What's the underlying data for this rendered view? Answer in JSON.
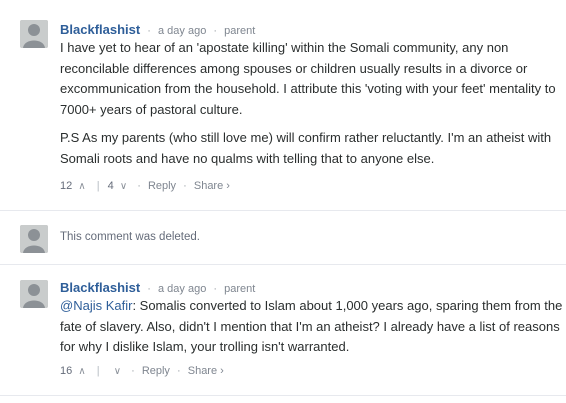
{
  "comments": [
    {
      "author": "Blackflashist",
      "time": "a day ago",
      "parent_label": "parent",
      "paragraphs": [
        "I have yet to hear of an 'apostate killing' within the Somali community, any non reconcilable differences among spouses or children usually results in a divorce or excommunication from the household. I attribute this 'voting with your feet' mentality to 7000+ years of pastoral culture.",
        "P.S As my parents (who still love me) will confirm rather reluctantly. I'm an atheist with Somali roots and have no qualms with telling that to anyone else."
      ],
      "upvotes": "12",
      "downvotes": "4",
      "reply_label": "Reply",
      "share_label": "Share ›"
    },
    {
      "deleted_text": "This comment was deleted."
    },
    {
      "author": "Blackflashist",
      "time": "a day ago",
      "parent_label": "parent",
      "mention": "@Najis Kafir",
      "text_after_mention": ": Somalis converted to Islam about 1,000 years ago, sparing them from the fate of slavery. Also, didn't I mention that I'm an atheist? I already have a list of reasons for why I dislike Islam, your trolling isn't warranted.",
      "upvotes": "16",
      "downvotes": "",
      "reply_label": "Reply",
      "share_label": "Share ›"
    }
  ],
  "icons": {
    "upvote": "chevron-up-icon",
    "downvote": "chevron-down-icon",
    "avatar": "default-avatar-icon"
  },
  "colors": {
    "author": "#2e5e99",
    "avatar": "#c9cccc",
    "meta": "#656c7a"
  }
}
